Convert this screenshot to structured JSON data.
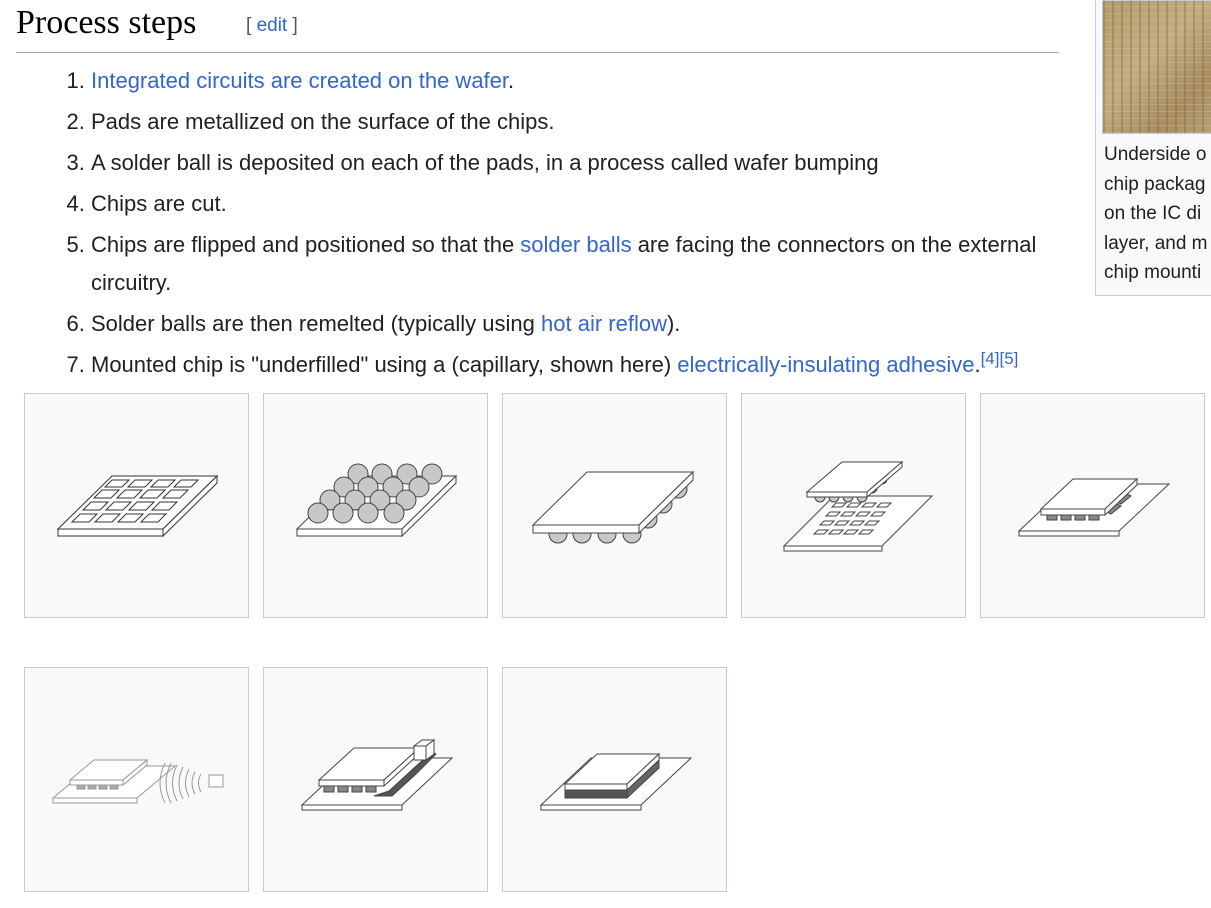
{
  "section": {
    "title": "Process steps",
    "edit_open": "[",
    "edit_label": "edit",
    "edit_close": "]"
  },
  "steps": [
    {
      "link": "Integrated circuits are created on the wafer",
      "after": "."
    },
    {
      "text": "Pads are metallized on the surface of the chips."
    },
    {
      "text": "A solder ball is deposited on each of the pads, in a process called wafer bumping"
    },
    {
      "text": "Chips are cut."
    },
    {
      "before": "Chips are flipped and positioned so that the ",
      "link": "solder balls",
      "after": " are facing the connectors on the external circuitry."
    },
    {
      "before": "Solder balls are then remelted (typically using ",
      "link": "hot air reflow",
      "after": ")."
    },
    {
      "before": "Mounted chip is \"underfilled\" using a (capillary, shown here) ",
      "link": "electrically-insulating adhesive",
      "after": ".",
      "refs": "[4][5]"
    }
  ],
  "side_thumbnail": {
    "caption_lines": [
      "Underside o",
      "chip packag",
      "on the IC di",
      "layer, and m",
      "chip mounti"
    ]
  },
  "gallery": {
    "items": [
      "wafer-with-chips-illustration",
      "solder-balls-on-pads-illustration",
      "cut-chip-illustration",
      "flipped-chip-positioning-illustration",
      "chip-on-connectors-illustration",
      "hot-air-reflow-illustration",
      "capillary-underfill-illustration",
      "mounted-chip-illustration"
    ]
  }
}
